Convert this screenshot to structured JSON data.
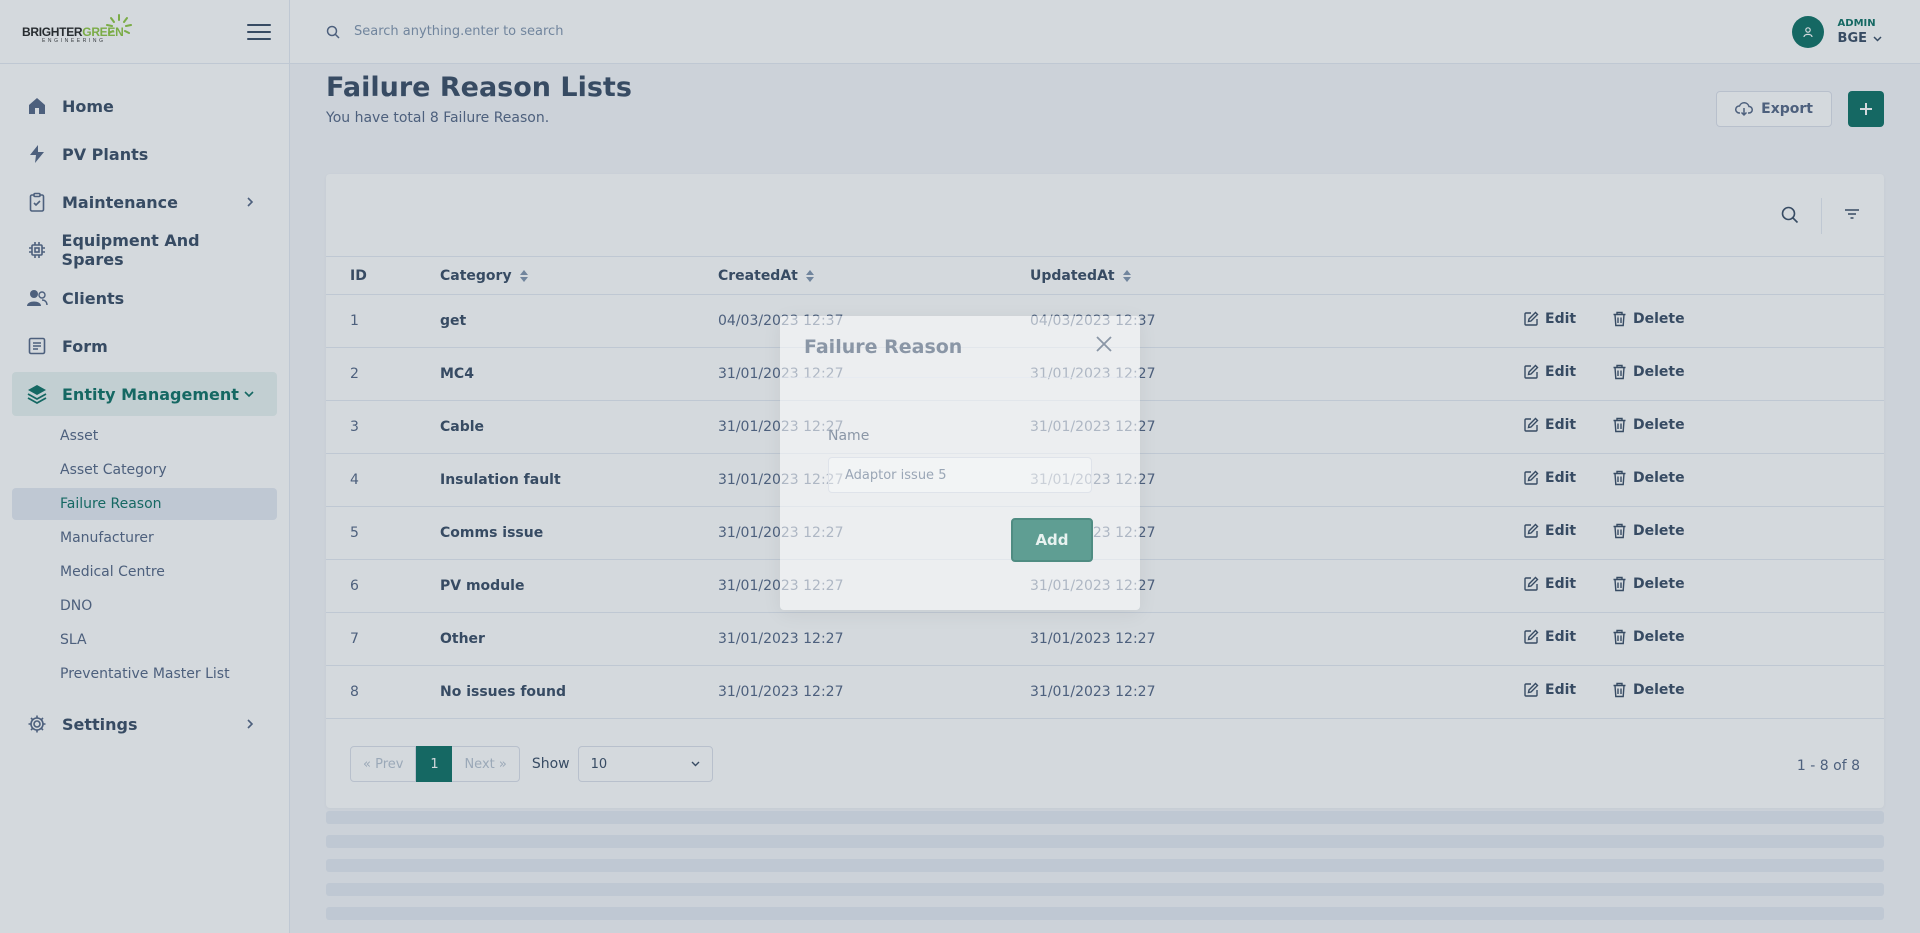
{
  "logo": {
    "text_a": "BRIGHTER",
    "text_b": "GREEN",
    "sub": "ENGINEERING"
  },
  "sidebar": {
    "items": [
      {
        "label": "Home",
        "icon": "home-icon"
      },
      {
        "label": "PV Plants",
        "icon": "bolt-icon"
      },
      {
        "label": "Maintenance",
        "icon": "clipboard-check-icon"
      },
      {
        "label": "Equipment And Spares",
        "icon": "chip-icon"
      },
      {
        "label": "Clients",
        "icon": "users-icon"
      },
      {
        "label": "Form",
        "icon": "form-icon"
      },
      {
        "label": "Entity Management",
        "icon": "layers-icon"
      },
      {
        "label": "Settings",
        "icon": "gear-icon"
      }
    ],
    "sub_items": [
      "Asset",
      "Asset Category",
      "Failure Reason",
      "Manufacturer",
      "Medical Centre",
      "DNO",
      "SLA",
      "Preventative Master List"
    ]
  },
  "header": {
    "search_placeholder": "Search anything.enter to search",
    "user_role": "ADMIN",
    "user_name": "BGE"
  },
  "page": {
    "title": "Failure Reason Lists",
    "subtitle": "You have total 8 Failure Reason.",
    "export_label": "Export"
  },
  "table": {
    "headers": {
      "id": "ID",
      "category": "Category",
      "created": "CreatedAt",
      "updated": "UpdatedAt"
    },
    "edit_label": "Edit",
    "delete_label": "Delete",
    "rows": [
      {
        "id": "1",
        "category": "get",
        "created": "04/03/2023 12:37",
        "updated": "04/03/2023 12:37"
      },
      {
        "id": "2",
        "category": "MC4",
        "created": "31/01/2023 12:27",
        "updated": "31/01/2023 12:27"
      },
      {
        "id": "3",
        "category": "Cable",
        "created": "31/01/2023 12:27",
        "updated": "31/01/2023 12:27"
      },
      {
        "id": "4",
        "category": "Insulation fault",
        "created": "31/01/2023 12:27",
        "updated": "31/01/2023 12:27"
      },
      {
        "id": "5",
        "category": "Comms issue",
        "created": "31/01/2023 12:27",
        "updated": "31/01/2023 12:27"
      },
      {
        "id": "6",
        "category": "PV module",
        "created": "31/01/2023 12:27",
        "updated": "31/01/2023 12:27"
      },
      {
        "id": "7",
        "category": "Other",
        "created": "31/01/2023 12:27",
        "updated": "31/01/2023 12:27"
      },
      {
        "id": "8",
        "category": "No issues found",
        "created": "31/01/2023 12:27",
        "updated": "31/01/2023 12:27"
      }
    ]
  },
  "pagination": {
    "prev": "« Prev",
    "current": "1",
    "next": "Next »",
    "show_label": "Show",
    "per_page": "10",
    "range": "1 - 8 of 8"
  },
  "modal": {
    "title": "Failure Reason",
    "field_label": "Name",
    "field_value": "Adaptor issue 5",
    "submit_label": "Add"
  },
  "colors": {
    "accent": "#0b6f63",
    "text": "#364a63",
    "muted": "#526484"
  }
}
